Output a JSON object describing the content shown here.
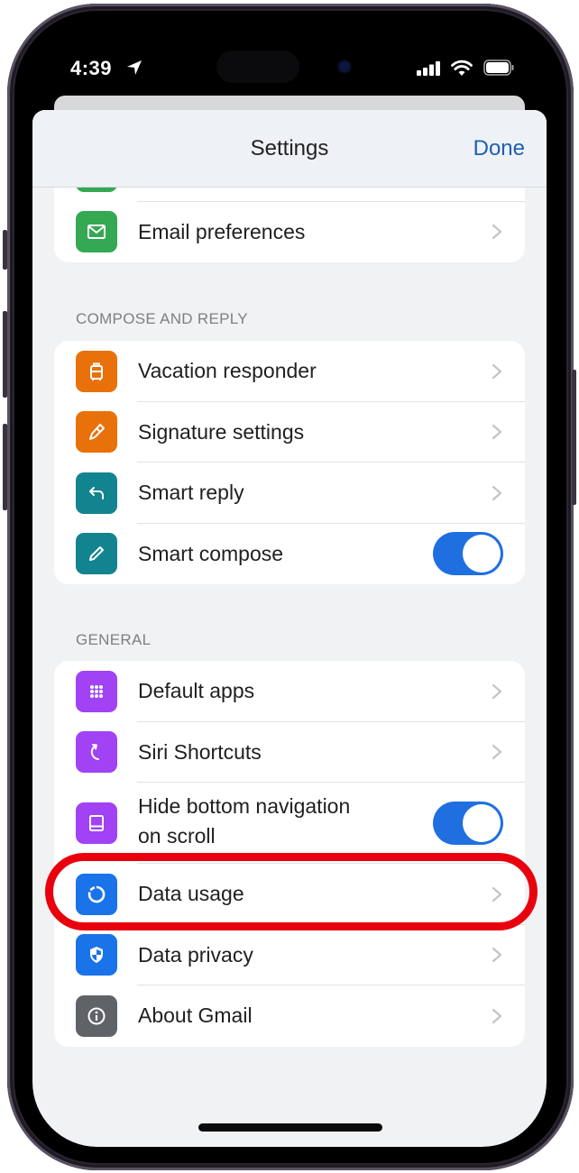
{
  "status_bar": {
    "time": "4:39",
    "icons": [
      "location-arrow-icon",
      "cellular-signal-icon",
      "wifi-icon",
      "battery-icon"
    ]
  },
  "nav": {
    "title": "Settings",
    "done_label": "Done"
  },
  "colors": {
    "accent_blue": "#1f5eb3",
    "toggle_on": "#1f6fe0",
    "highlight_red": "#e8000d",
    "green": "#34a853",
    "orange": "#e8710a",
    "teal": "#12848f",
    "purple": "#a142f4",
    "blue": "#1a73e8",
    "gray": "#5f6368"
  },
  "groups": [
    {
      "header": "",
      "items": [
        {
          "label": "",
          "icon": "green-icon-partial",
          "control": "chevron"
        },
        {
          "label": "Email preferences",
          "icon": "mail-icon",
          "control": "chevron"
        }
      ]
    },
    {
      "header": "COMPOSE AND REPLY",
      "items": [
        {
          "label": "Vacation responder",
          "icon": "suitcase-icon",
          "control": "chevron"
        },
        {
          "label": "Signature settings",
          "icon": "pen-icon",
          "control": "chevron"
        },
        {
          "label": "Smart reply",
          "icon": "reply-icon",
          "control": "chevron"
        },
        {
          "label": "Smart compose",
          "icon": "pencil-icon",
          "control": "toggle",
          "value": true
        }
      ]
    },
    {
      "header": "GENERAL",
      "items": [
        {
          "label": "Default apps",
          "icon": "grid-icon",
          "control": "chevron"
        },
        {
          "label": "Siri Shortcuts",
          "icon": "shortcut-arrow-icon",
          "control": "chevron"
        },
        {
          "label": "Hide bottom navigation on scroll",
          "label_line1": "Hide bottom navigation",
          "label_line2": "on scroll",
          "icon": "bottom-bar-icon",
          "control": "toggle",
          "value": true
        },
        {
          "label": "Data usage",
          "icon": "data-usage-icon",
          "control": "chevron",
          "highlighted": true
        },
        {
          "label": "Data privacy",
          "icon": "shield-icon",
          "control": "chevron"
        },
        {
          "label": "About Gmail",
          "icon": "info-icon",
          "control": "chevron"
        }
      ]
    }
  ]
}
